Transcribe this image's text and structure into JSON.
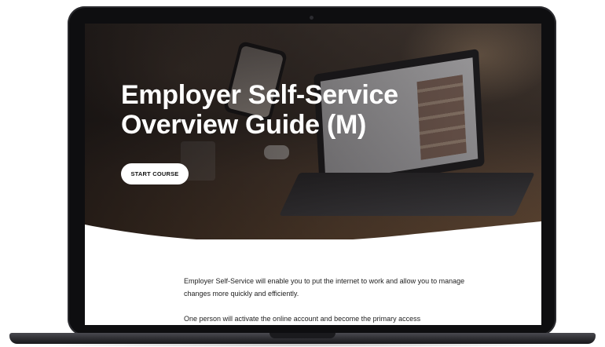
{
  "hero": {
    "title": "Employer Self-Service Overview Guide (M)",
    "start_button_label": "START COURSE"
  },
  "content": {
    "paragraphs": [
      "Employer Self-Service will enable you to put the internet to work and allow you to manage changes more quickly and efficiently.",
      "One person will activate the online account and become the primary access"
    ]
  },
  "colors": {
    "bezel": "#0e0e10",
    "button_bg": "#ffffff",
    "title_text": "#ffffff",
    "body_text": "#222222"
  }
}
